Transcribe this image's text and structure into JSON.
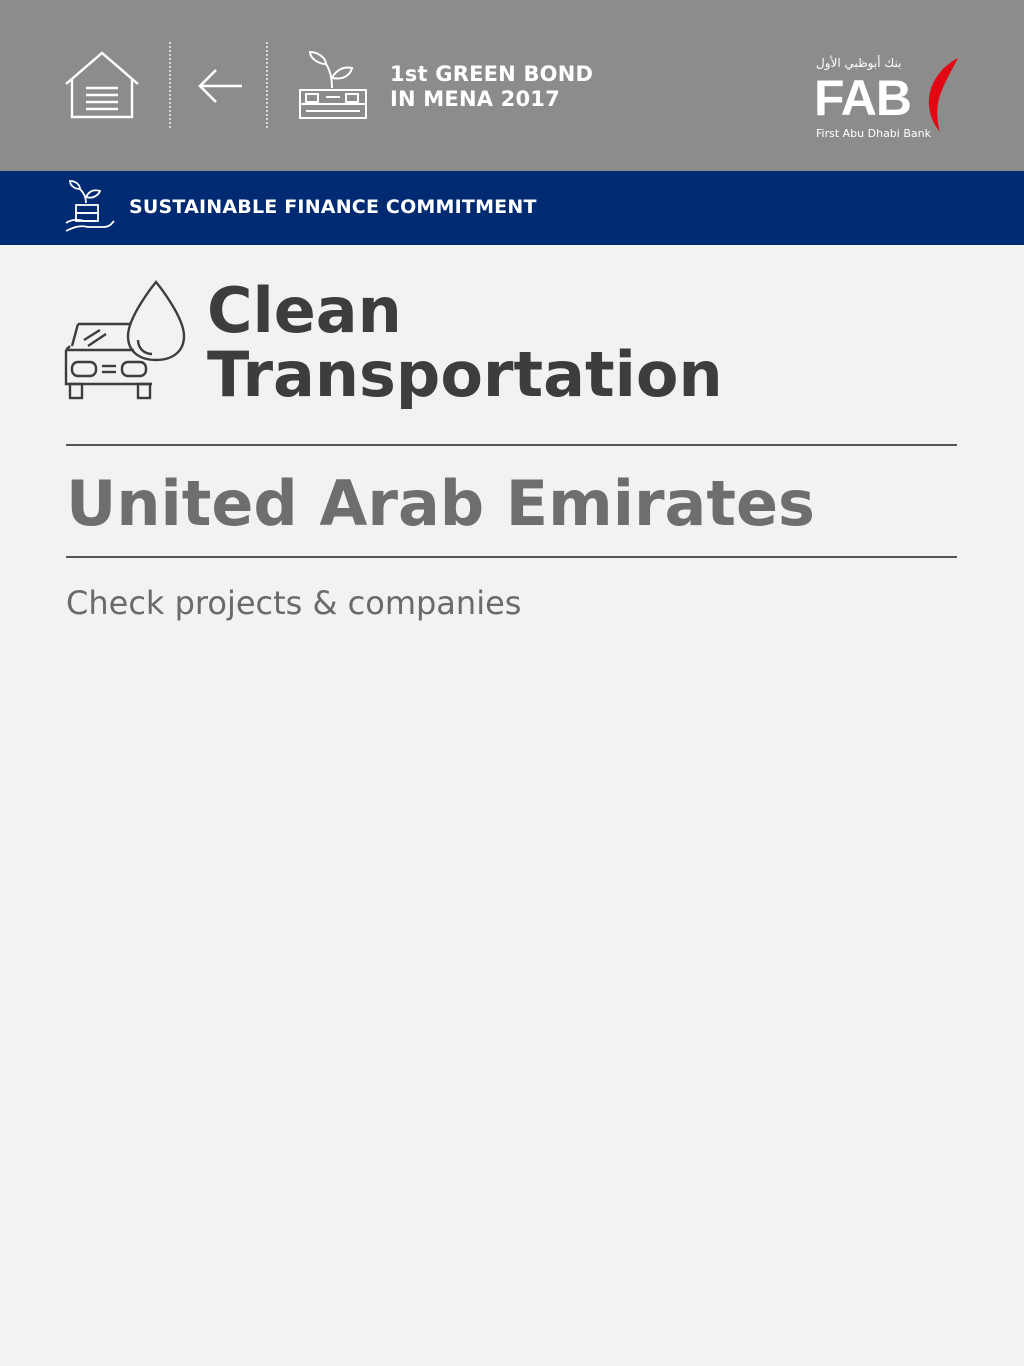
{
  "header": {
    "home_icon": "home-icon",
    "back_icon": "back-arrow-icon",
    "bond_icon": "plant-money-icon",
    "bond_title_line1": "1st GREEN BOND",
    "bond_title_line2": "IN MENA 2017",
    "logo": {
      "arabic": "بنك أبوظبي الأول",
      "text": "FAB",
      "subtitle": "First Abu Dhabi Bank"
    }
  },
  "banner": {
    "icon": "hand-plant-icon",
    "label": "SUSTAINABLE FINANCE COMMITMENT"
  },
  "category": {
    "icon": "car-water-drop-icon",
    "title_line1": "Clean",
    "title_line2": "Transportation"
  },
  "country": "United Arab Emirates",
  "link": "Check projects & companies",
  "colors": {
    "header_bg": "#8c8c8c",
    "banner_bg": "#002a72",
    "page_bg": "#f2f2f2",
    "logo_accent": "#e30613"
  }
}
